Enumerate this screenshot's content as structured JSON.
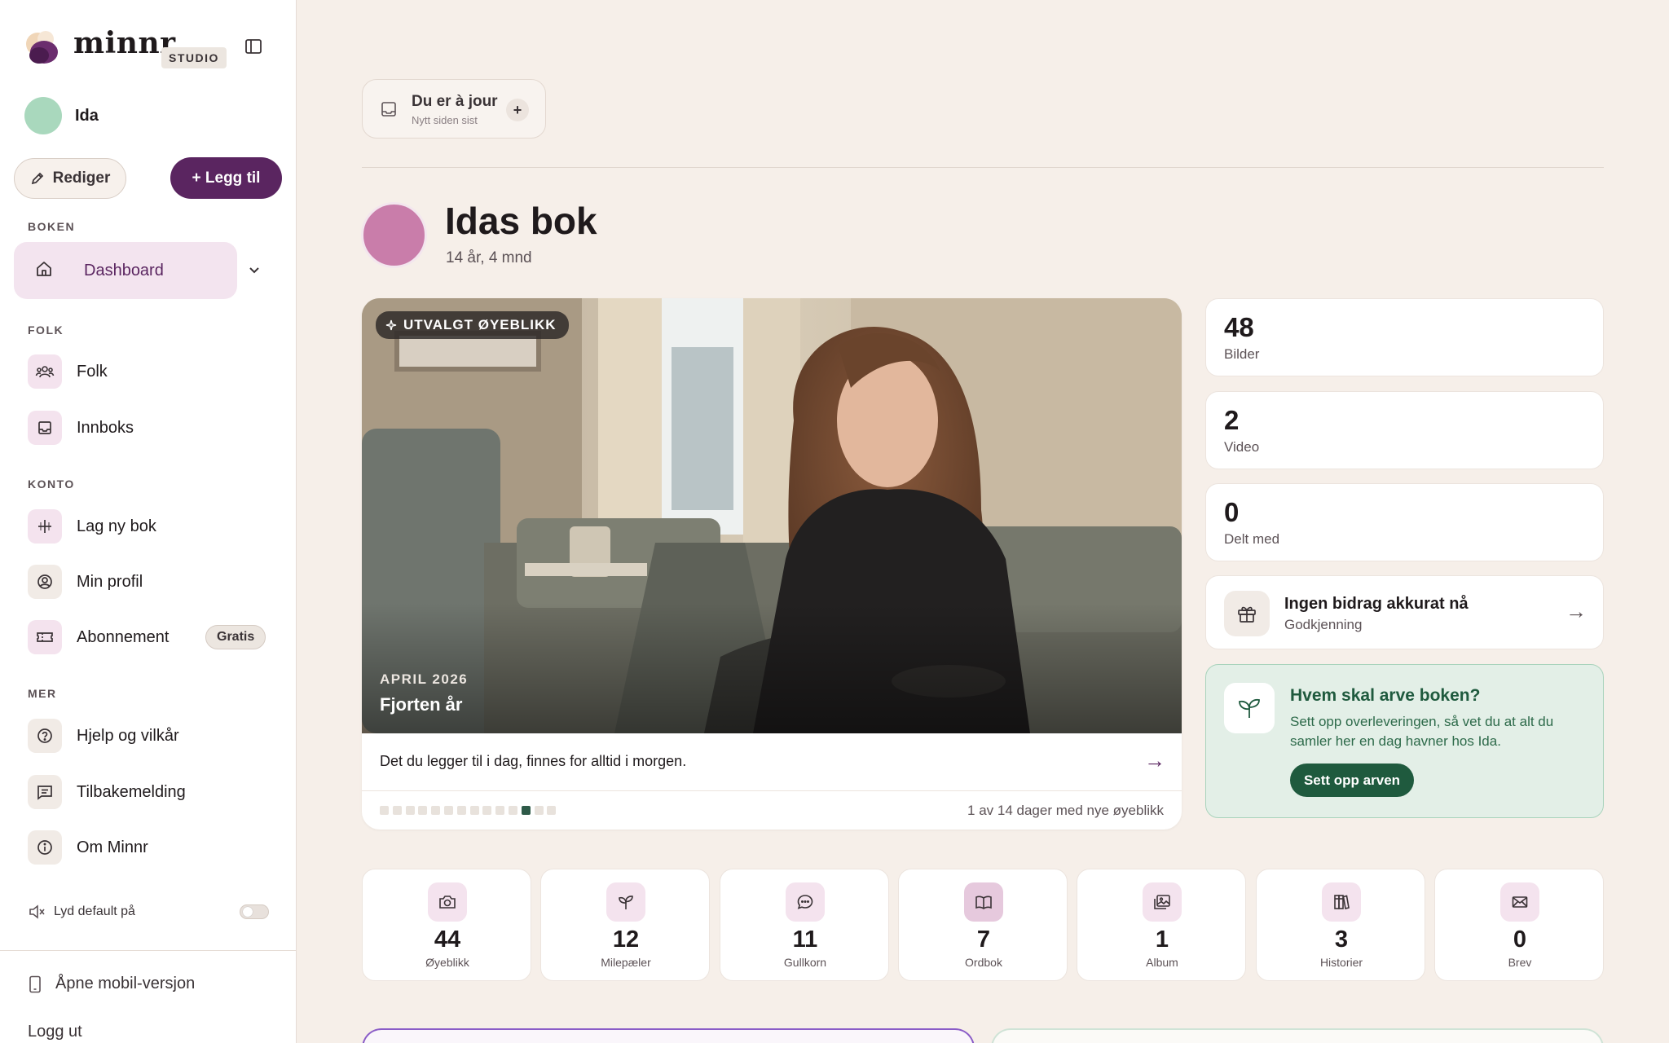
{
  "app": {
    "brand": "minnr",
    "badge": "STUDIO"
  },
  "user": {
    "name": "Ida",
    "avatar_color": "#a9d8bd"
  },
  "actions": {
    "edit_label": "Rediger",
    "add_label": "+ Legg til"
  },
  "nav": {
    "section_book": "BOKEN",
    "dashboard": "Dashboard",
    "section_people": "FOLK",
    "people": "Folk",
    "inbox": "Innboks",
    "section_account": "KONTO",
    "new_book": "Lag ny bok",
    "profile": "Min profil",
    "subscription": "Abonnement",
    "subscription_badge": "Gratis",
    "section_more": "MER",
    "help": "Hjelp og vilkår",
    "feedback": "Tilbakemelding",
    "about": "Om Minnr",
    "sound": "Lyd default på",
    "sound_on": false,
    "mobile": "Åpne mobil-versjon",
    "logout": "Logg ut"
  },
  "status": {
    "title": "Du er à jour",
    "subtitle": "Nytt siden sist"
  },
  "book": {
    "title": "Idas bok",
    "age": "14 år, 4 mnd",
    "avatar_color": "#c97daa"
  },
  "featured": {
    "tag": "UTVALGT ØYEBLIKK",
    "date": "APRIL 2026",
    "caption": "Fjorten år",
    "quote": "Det du legger til i dag, finnes for alltid i morgen.",
    "progress_text": "1 av 14 dager med nye øyeblikk",
    "dots_total": 14,
    "dot_active": 12
  },
  "stats": [
    {
      "value": "48",
      "label": "Bilder"
    },
    {
      "value": "2",
      "label": "Video"
    },
    {
      "value": "0",
      "label": "Delt med"
    }
  ],
  "contributions": {
    "title": "Ingen bidrag akkurat nå",
    "subtitle": "Godkjenning"
  },
  "inheritance": {
    "title": "Hvem skal arve boken?",
    "text": "Sett opp overleveringen, så vet du at alt du samler her en dag havner hos Ida.",
    "button": "Sett opp arven"
  },
  "categories": [
    {
      "value": "44",
      "label": "Øyeblikk",
      "icon": "camera-icon"
    },
    {
      "value": "12",
      "label": "Milepæler",
      "icon": "sprout-icon"
    },
    {
      "value": "11",
      "label": "Gullkorn",
      "icon": "chat-bubble-icon"
    },
    {
      "value": "7",
      "label": "Ordbok",
      "icon": "book-icon"
    },
    {
      "value": "1",
      "label": "Album",
      "icon": "photo-album-icon"
    },
    {
      "value": "3",
      "label": "Historier",
      "icon": "books-icon"
    },
    {
      "value": "0",
      "label": "Brev",
      "icon": "envelope-icon"
    }
  ],
  "colors": {
    "accent": "#5a2560",
    "accent_soft": "#f3e4ef",
    "success": "#1f5a3e",
    "success_soft": "#e3efe7",
    "background": "#f6efe9"
  }
}
